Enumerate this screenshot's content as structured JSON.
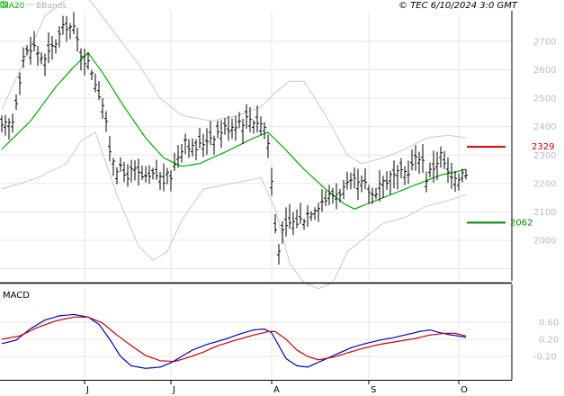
{
  "header": {
    "legend": [
      {
        "label": "MA20",
        "color": "#00aa00"
      },
      {
        "label": "BBands",
        "color": "#c8c8c8"
      }
    ],
    "copyright": "© TEC 6/10/2024 3:0 GMT"
  },
  "colors": {
    "bar": "#000000",
    "ma": "#00aa00",
    "bb": "#c8c8c8",
    "grid": "#e6e6e6",
    "frame": "#000000",
    "resistance": "#cc0000",
    "support": "#008800",
    "macd": "#0000cc",
    "signal": "#cc0000"
  },
  "chart_data": [
    {
      "type": "line",
      "title": "",
      "ylim": [
        1820,
        2880
      ],
      "yticks": [
        "2000",
        "2100",
        "2200",
        "2300",
        "2400",
        "2500",
        "2600",
        "2700"
      ],
      "ytick_values": [
        2000,
        2100,
        2200,
        2300,
        2400,
        2500,
        2600,
        2700
      ],
      "xticks": [
        {
          "label": "J",
          "index": 23
        },
        {
          "label": "J",
          "index": 47
        },
        {
          "label": "A",
          "index": 75
        },
        {
          "label": "S",
          "index": 102
        },
        {
          "label": "O",
          "index": 127
        }
      ],
      "n": 130,
      "price_series": "OHLC",
      "close_anchors": [
        [
          0,
          2390
        ],
        [
          3,
          2420
        ],
        [
          6,
          2650
        ],
        [
          9,
          2680
        ],
        [
          12,
          2630
        ],
        [
          15,
          2700
        ],
        [
          18,
          2760
        ],
        [
          20,
          2740
        ],
        [
          22,
          2660
        ],
        [
          25,
          2600
        ],
        [
          27,
          2520
        ],
        [
          28,
          2480
        ],
        [
          30,
          2320
        ],
        [
          32,
          2260
        ],
        [
          34,
          2230
        ],
        [
          37,
          2240
        ],
        [
          40,
          2210
        ],
        [
          43,
          2230
        ],
        [
          45,
          2210
        ],
        [
          47,
          2230
        ],
        [
          49,
          2300
        ],
        [
          51,
          2360
        ],
        [
          53,
          2320
        ],
        [
          55,
          2330
        ],
        [
          57,
          2360
        ],
        [
          60,
          2380
        ],
        [
          63,
          2400
        ],
        [
          66,
          2420
        ],
        [
          69,
          2430
        ],
        [
          71,
          2420
        ],
        [
          73,
          2400
        ],
        [
          74,
          2340
        ],
        [
          75,
          2210
        ],
        [
          76,
          2040
        ],
        [
          77,
          1980
        ],
        [
          78,
          2020
        ],
        [
          80,
          2060
        ],
        [
          83,
          2070
        ],
        [
          86,
          2110
        ],
        [
          89,
          2140
        ],
        [
          92,
          2160
        ],
        [
          95,
          2180
        ],
        [
          98,
          2200
        ],
        [
          101,
          2190
        ],
        [
          103,
          2160
        ],
        [
          105,
          2200
        ],
        [
          108,
          2220
        ],
        [
          111,
          2230
        ],
        [
          114,
          2260
        ],
        [
          116,
          2300
        ],
        [
          117,
          2280
        ],
        [
          118,
          2220
        ],
        [
          120,
          2260
        ],
        [
          122,
          2300
        ],
        [
          123,
          2270
        ],
        [
          124,
          2230
        ],
        [
          126,
          2200
        ],
        [
          127,
          2220
        ],
        [
          128,
          2250
        ],
        [
          129,
          2240
        ]
      ],
      "ma20_anchors": [
        [
          0,
          2320
        ],
        [
          8,
          2420
        ],
        [
          15,
          2540
        ],
        [
          20,
          2610
        ],
        [
          24,
          2660
        ],
        [
          28,
          2590
        ],
        [
          34,
          2470
        ],
        [
          40,
          2360
        ],
        [
          45,
          2290
        ],
        [
          50,
          2260
        ],
        [
          55,
          2270
        ],
        [
          62,
          2310
        ],
        [
          70,
          2360
        ],
        [
          74,
          2380
        ],
        [
          78,
          2330
        ],
        [
          84,
          2250
        ],
        [
          90,
          2180
        ],
        [
          95,
          2130
        ],
        [
          98,
          2110
        ],
        [
          102,
          2130
        ],
        [
          108,
          2160
        ],
        [
          114,
          2190
        ],
        [
          118,
          2210
        ],
        [
          122,
          2230
        ],
        [
          126,
          2240
        ],
        [
          129,
          2250
        ]
      ],
      "bb_upper_anchors": [
        [
          0,
          2460
        ],
        [
          12,
          2790
        ],
        [
          18,
          2850
        ],
        [
          22,
          2880
        ],
        [
          26,
          2820
        ],
        [
          32,
          2720
        ],
        [
          38,
          2620
        ],
        [
          44,
          2500
        ],
        [
          50,
          2440
        ],
        [
          58,
          2420
        ],
        [
          66,
          2440
        ],
        [
          72,
          2470
        ],
        [
          76,
          2520
        ],
        [
          80,
          2560
        ],
        [
          84,
          2560
        ],
        [
          90,
          2440
        ],
        [
          96,
          2300
        ],
        [
          100,
          2270
        ],
        [
          106,
          2290
        ],
        [
          112,
          2320
        ],
        [
          118,
          2360
        ],
        [
          124,
          2370
        ],
        [
          129,
          2360
        ]
      ],
      "bb_lower_anchors": [
        [
          0,
          2180
        ],
        [
          10,
          2220
        ],
        [
          18,
          2270
        ],
        [
          22,
          2350
        ],
        [
          26,
          2380
        ],
        [
          32,
          2160
        ],
        [
          38,
          1980
        ],
        [
          42,
          1930
        ],
        [
          46,
          1960
        ],
        [
          50,
          2070
        ],
        [
          56,
          2180
        ],
        [
          64,
          2200
        ],
        [
          72,
          2220
        ],
        [
          76,
          2110
        ],
        [
          80,
          1920
        ],
        [
          84,
          1850
        ],
        [
          88,
          1830
        ],
        [
          92,
          1850
        ],
        [
          96,
          1960
        ],
        [
          100,
          2000
        ],
        [
          106,
          2060
        ],
        [
          112,
          2080
        ],
        [
          118,
          2120
        ],
        [
          124,
          2140
        ],
        [
          129,
          2160
        ]
      ],
      "resistance": {
        "value": 2329,
        "label": "2329"
      },
      "support": {
        "value": 2062,
        "label": "2062"
      }
    },
    {
      "type": "line",
      "title": "MACD",
      "ylim": [
        -60,
        100
      ],
      "yticks": [
        "0.60",
        "0.20",
        "-0.20"
      ],
      "ytick_values": [
        60,
        20,
        -20
      ],
      "series": [
        {
          "color": "#0000cc",
          "anchors": [
            [
              0,
              10
            ],
            [
              4,
              18
            ],
            [
              8,
              45
            ],
            [
              12,
              65
            ],
            [
              16,
              75
            ],
            [
              20,
              78
            ],
            [
              24,
              72
            ],
            [
              27,
              55
            ],
            [
              30,
              20
            ],
            [
              33,
              -20
            ],
            [
              36,
              -42
            ],
            [
              40,
              -48
            ],
            [
              44,
              -45
            ],
            [
              47,
              -35
            ],
            [
              50,
              -20
            ],
            [
              53,
              -5
            ],
            [
              57,
              8
            ],
            [
              62,
              20
            ],
            [
              66,
              32
            ],
            [
              70,
              42
            ],
            [
              73,
              44
            ],
            [
              75,
              35
            ],
            [
              77,
              5
            ],
            [
              79,
              -25
            ],
            [
              82,
              -42
            ],
            [
              85,
              -45
            ],
            [
              89,
              -30
            ],
            [
              93,
              -15
            ],
            [
              97,
              0
            ],
            [
              101,
              10
            ],
            [
              105,
              18
            ],
            [
              109,
              24
            ],
            [
              113,
              32
            ],
            [
              116,
              38
            ],
            [
              119,
              42
            ],
            [
              122,
              35
            ],
            [
              125,
              30
            ],
            [
              129,
              25
            ]
          ]
        },
        {
          "color": "#cc0000",
          "anchors": [
            [
              0,
              20
            ],
            [
              5,
              28
            ],
            [
              10,
              48
            ],
            [
              15,
              63
            ],
            [
              20,
              72
            ],
            [
              24,
              72
            ],
            [
              28,
              58
            ],
            [
              32,
              30
            ],
            [
              36,
              5
            ],
            [
              40,
              -18
            ],
            [
              44,
              -30
            ],
            [
              48,
              -32
            ],
            [
              52,
              -22
            ],
            [
              56,
              -10
            ],
            [
              60,
              5
            ],
            [
              65,
              18
            ],
            [
              70,
              30
            ],
            [
              74,
              38
            ],
            [
              76,
              38
            ],
            [
              79,
              20
            ],
            [
              82,
              -5
            ],
            [
              85,
              -20
            ],
            [
              88,
              -28
            ],
            [
              92,
              -22
            ],
            [
              96,
              -12
            ],
            [
              100,
              -2
            ],
            [
              105,
              8
            ],
            [
              110,
              15
            ],
            [
              115,
              22
            ],
            [
              119,
              30
            ],
            [
              123,
              34
            ],
            [
              126,
              34
            ],
            [
              129,
              28
            ]
          ]
        }
      ]
    }
  ]
}
